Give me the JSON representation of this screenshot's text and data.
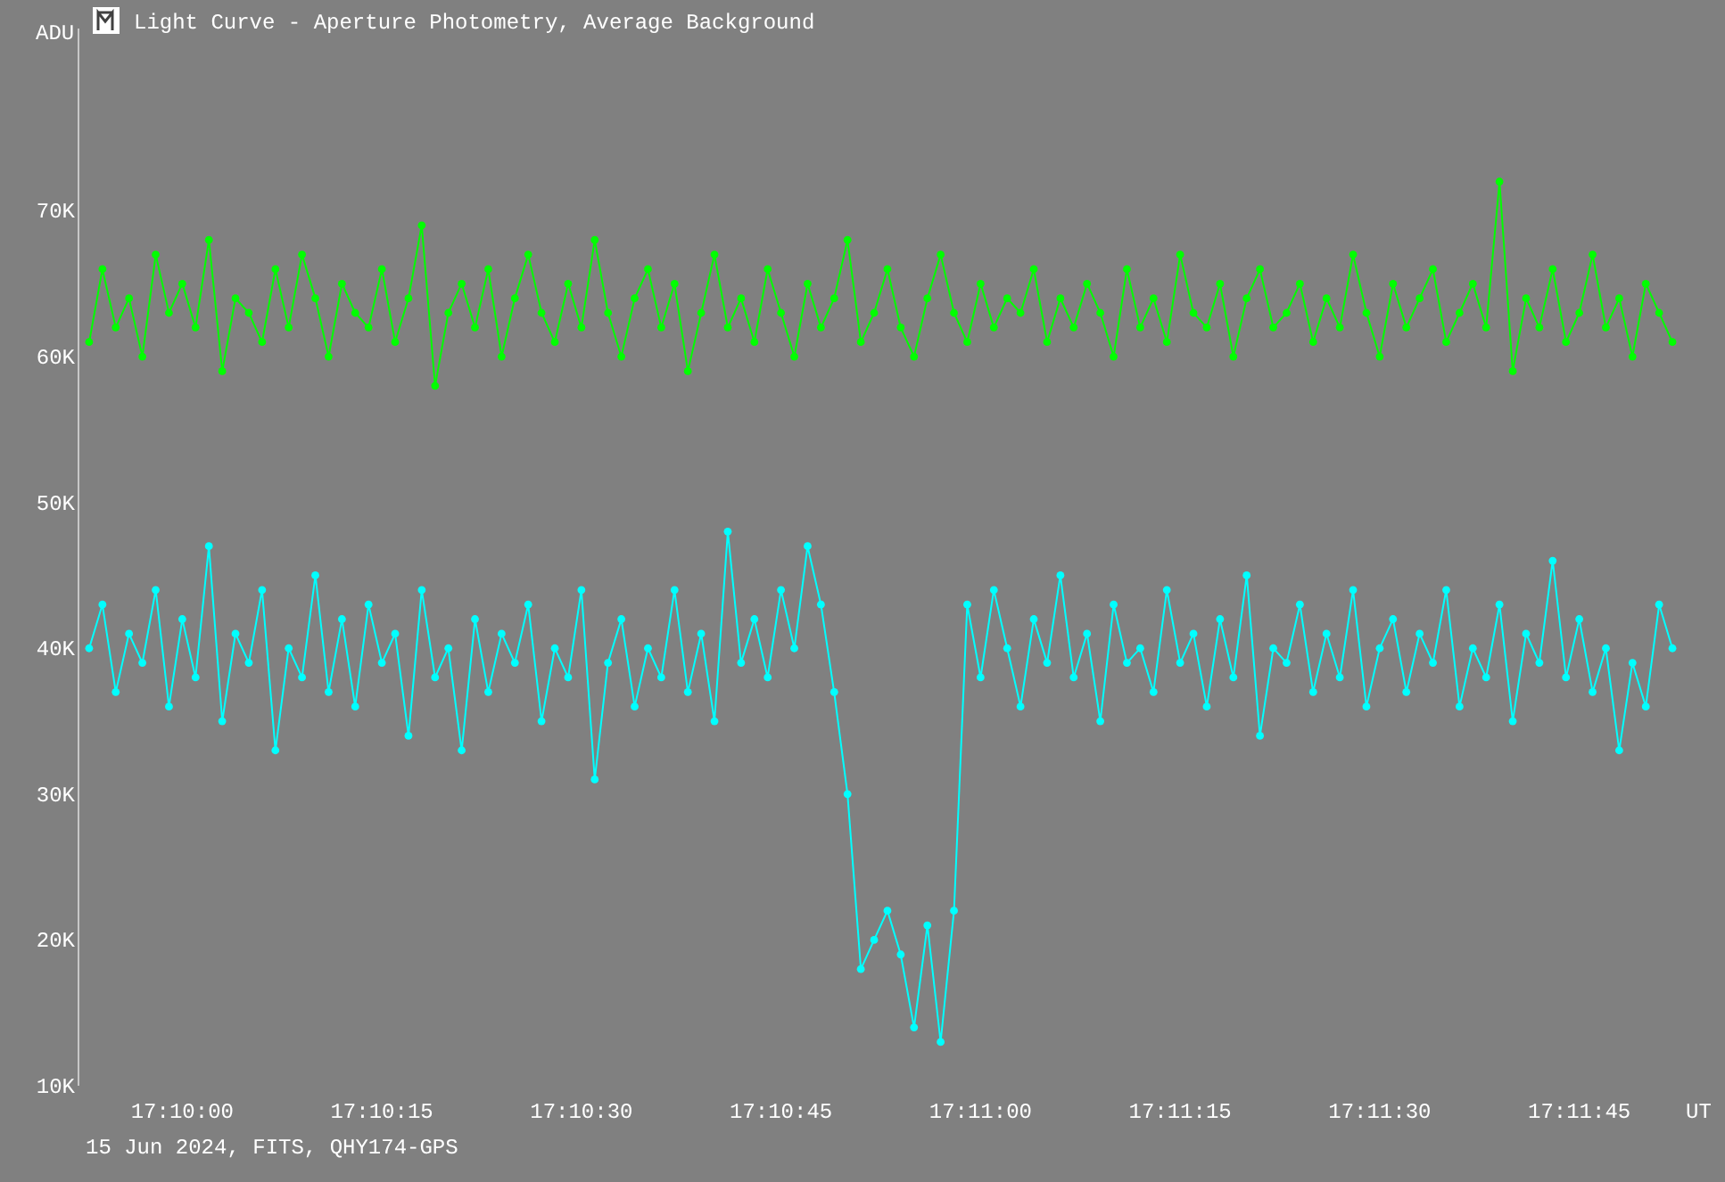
{
  "window": {
    "title": "Light Curve - Aperture Photometry, Average Background"
  },
  "chart": {
    "chart_data": {
      "type": "line",
      "xlabel": "UT",
      "annotations": [
        {
          "text": "ADU"
        }
      ],
      "ylim": [
        10,
        82.5
      ],
      "categories": [
        null,
        null,
        null,
        null,
        null,
        null,
        null,
        "17:10:00",
        null,
        null,
        null,
        null,
        null,
        null,
        null,
        null,
        null,
        null,
        null,
        null,
        null,
        null,
        "17:10:15",
        null,
        null,
        null,
        null,
        null,
        null,
        null,
        null,
        null,
        null,
        null,
        null,
        null,
        null,
        "17:10:30",
        null,
        null,
        null,
        null,
        null,
        null,
        null,
        null,
        null,
        null,
        null,
        null,
        null,
        null,
        "17:10:45",
        null,
        null,
        null,
        null,
        null,
        null,
        null,
        null,
        null,
        null,
        null,
        null,
        null,
        null,
        "17:11:00",
        null,
        null,
        null,
        null,
        null,
        null,
        null,
        null,
        null,
        null,
        null,
        null,
        null,
        null,
        "17:11:15",
        null,
        null,
        null,
        null,
        null,
        null,
        null,
        null,
        null,
        null,
        null,
        null,
        null,
        null,
        "17:11:30",
        null,
        null,
        null,
        null,
        null,
        null,
        null,
        null,
        null,
        null,
        null,
        null,
        null,
        null,
        "17:11:45",
        null,
        null,
        null,
        null,
        null,
        null,
        null
      ],
      "yticks": [
        {
          "value": 10,
          "label": "10K"
        },
        {
          "value": 20,
          "label": "20K"
        },
        {
          "value": 30,
          "label": "30K"
        },
        {
          "value": 40,
          "label": "40K"
        },
        {
          "value": 50,
          "label": "50K"
        },
        {
          "value": 60,
          "label": "60K"
        },
        {
          "value": 70,
          "label": "70K"
        }
      ],
      "series": [
        {
          "color": "#00ff00",
          "marker": "circle",
          "values": [
            61,
            66,
            62,
            64,
            60,
            67,
            63,
            65,
            62,
            68,
            59,
            64,
            63,
            61,
            66,
            62,
            67,
            64,
            60,
            65,
            63,
            62,
            66,
            61,
            64,
            69,
            58,
            63,
            65,
            62,
            66,
            60,
            64,
            67,
            63,
            61,
            65,
            62,
            68,
            63,
            60,
            64,
            66,
            62,
            65,
            59,
            63,
            67,
            62,
            64,
            61,
            66,
            63,
            60,
            65,
            62,
            64,
            68,
            61,
            63,
            66,
            62,
            60,
            64,
            67,
            63,
            61,
            65,
            62,
            64,
            63,
            66,
            61,
            64,
            62,
            65,
            63,
            60,
            66,
            62,
            64,
            61,
            67,
            63,
            62,
            65,
            60,
            64,
            66,
            62,
            63,
            65,
            61,
            64,
            62,
            67,
            63,
            60,
            65,
            62,
            64,
            66,
            61,
            63,
            65,
            62,
            72,
            59,
            64,
            62,
            66,
            61,
            63,
            67,
            62,
            64,
            60,
            65,
            63,
            61
          ]
        },
        {
          "color": "#00ffff",
          "marker": "circle",
          "values": [
            40,
            43,
            37,
            41,
            39,
            44,
            36,
            42,
            38,
            47,
            35,
            41,
            39,
            44,
            33,
            40,
            38,
            45,
            37,
            42,
            36,
            43,
            39,
            41,
            34,
            44,
            38,
            40,
            33,
            42,
            37,
            41,
            39,
            43,
            35,
            40,
            38,
            44,
            31,
            39,
            42,
            36,
            40,
            38,
            44,
            37,
            41,
            35,
            48,
            39,
            42,
            38,
            44,
            40,
            47,
            43,
            37,
            30,
            18,
            20,
            22,
            19,
            14,
            21,
            13,
            22,
            43,
            38,
            44,
            40,
            36,
            42,
            39,
            45,
            38,
            41,
            35,
            43,
            39,
            40,
            37,
            44,
            39,
            41,
            36,
            42,
            38,
            45,
            34,
            40,
            39,
            43,
            37,
            41,
            38,
            44,
            36,
            40,
            42,
            37,
            41,
            39,
            44,
            36,
            40,
            38,
            43,
            35,
            41,
            39,
            46,
            38,
            42,
            37,
            40,
            33,
            39,
            36,
            43,
            40
          ]
        }
      ]
    }
  },
  "footer": "15 Jun 2024, FITS, QHY174-GPS"
}
